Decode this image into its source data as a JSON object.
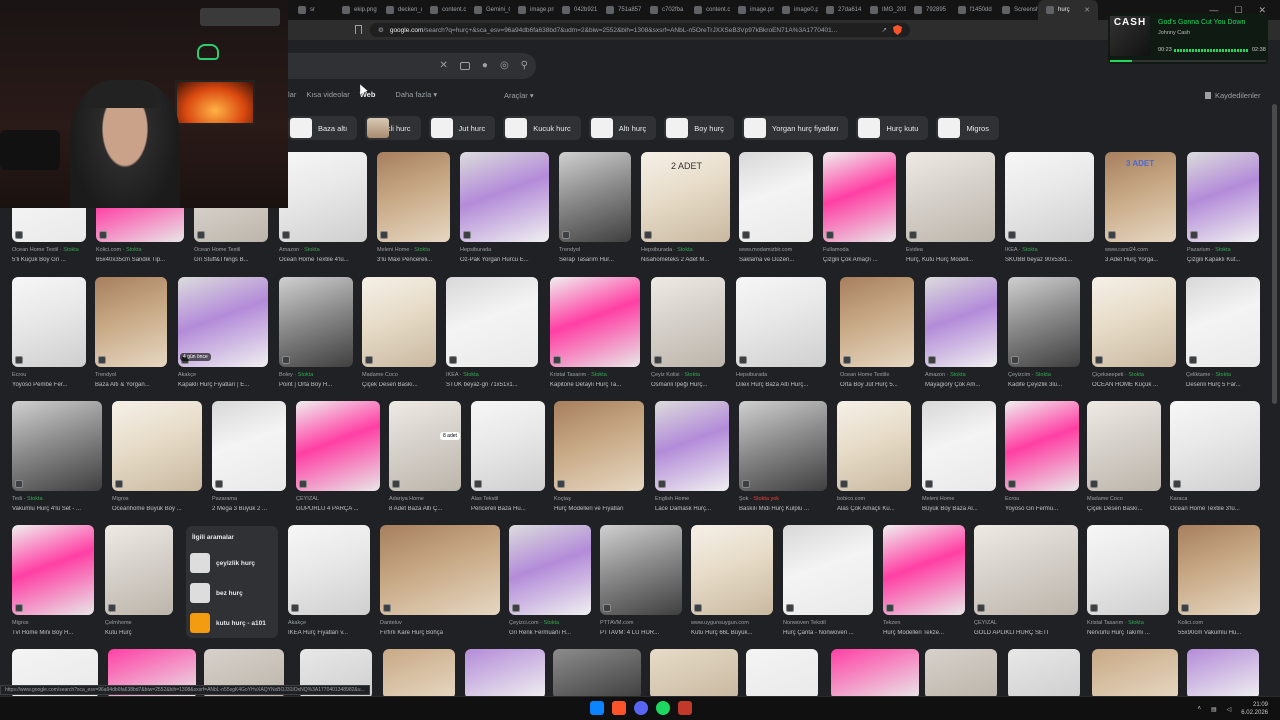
{
  "browser": {
    "tabs": [
      "sr",
      "ekip.png",
      "decken_d",
      "content.c",
      "Gemini_C",
      "image.pn",
      "042b921",
      "751a857",
      "c702fba",
      "content.c",
      "image.pn",
      "image0.p",
      "27da614",
      "IMG_209",
      "792895",
      "f1450dd",
      "Screensh",
      "hurç"
    ],
    "active_tab": "hurç",
    "url_host": "google.com",
    "url_rest": "/search?q=hurç+&sca_esv=96a94db6fa638bd7&udm=2&biw=2552&bih=1308&sxsrf=ANbL-n5OreTrJXXSeB3Vp97kBkroEN71A%3A1770401...",
    "status_url": "https://www.google.com/search?sca_esv=96a94db6fa638bd7&biw=2552&bih=1308&sxsrf=ANbL-n55sgK4GoYHvXAQYNxBOJ31IOxNQ%3A1770401348982&u..."
  },
  "music": {
    "art_text": "CASH",
    "song": "God's Gonna Cut You Down",
    "artist": "Johnny Cash",
    "time_elapsed": "00:23",
    "time_total": "02:38",
    "progress": 0.14
  },
  "search": {
    "nav": [
      "lar",
      "Kısa videolar",
      "Web",
      "Daha fazla ▾"
    ],
    "selected_nav": "Web",
    "tools": "Araçlar ▾",
    "saved": "Kaydedilenler",
    "chips": [
      "Baza altı",
      "Destekli hurc",
      "Jut hurc",
      "Kucuk hurc",
      "Altı hurç",
      "Boy hurç",
      "Yorgan hurç fiyatları",
      "Hurç kutu",
      "Migros"
    ]
  },
  "rows": [
    {
      "items": [
        {
          "source": "Ocean Home Textil",
          "stock": true,
          "title": "5'li Küçük Boy Gri ..."
        },
        {
          "source": "Kolici.com",
          "stock": true,
          "title": "65x40x35cm Sandık Tip..."
        },
        {
          "source": "Ocean Home Textil",
          "stock": false,
          "title": "Gri Stuff&Things B..."
        },
        {
          "source": "Amazon",
          "stock": true,
          "title": "Ocean Home Textile 4'lü..."
        },
        {
          "source": "Meleni Home",
          "stock": true,
          "title": "3'lü Maxi Pencereli..."
        },
        {
          "source": "Hepsiburada",
          "stock": false,
          "title": "Öz-Pak Yorgan Hurcu E..."
        },
        {
          "source": "Trendyol",
          "stock": false,
          "title": "Serap Tasarım Hur..."
        },
        {
          "source": "Hepsiburada",
          "stock": true,
          "title": "Nisahometeks 2 Adet M..."
        },
        {
          "source": "www.modamizbir.com",
          "stock": false,
          "title": "Saklama ve Düzen..."
        },
        {
          "source": "Fullamoda",
          "stock": false,
          "title": "Çizgili Çok Amaçlı ..."
        },
        {
          "source": "Evidea",
          "stock": false,
          "title": "Hurç, Kutu Hurç Modell..."
        },
        {
          "source": "IKEA",
          "stock": true,
          "title": "SKUBB beyaz 90x53x1..."
        },
        {
          "source": "www.carsi24.com",
          "stock": false,
          "title": "3 Adet Hurç Yorga..."
        },
        {
          "source": "Pazarium",
          "stock": true,
          "title": "Çizgili Kapaklı Kut..."
        }
      ]
    },
    {
      "items": [
        {
          "source": "Ecrou",
          "stock": false,
          "title": "Yoyoso Pembe Fer..."
        },
        {
          "source": "Trendyol",
          "stock": false,
          "title": "Baza Altı & Yorgan..."
        },
        {
          "source": "Akakçe",
          "stock": false,
          "title": "Kapaklı Hurç Fiyatları | E..."
        },
        {
          "source": "Boley",
          "stock": true,
          "title": "Point | Orta Boy H..."
        },
        {
          "source": "Madame Coco",
          "stock": false,
          "title": "Çiçek Desen Baskı..."
        },
        {
          "source": "IKEA",
          "stock": true,
          "title": "STUK beyaz-gri 71x51x1..."
        },
        {
          "source": "Kristal Tasarım",
          "stock": true,
          "title": "Kapitone Detaylı Hurç Ta..."
        },
        {
          "source": "Çeyiz Kolisi",
          "stock": true,
          "title": "Osmanlı İpeği Hurç..."
        },
        {
          "source": "Hepsiburada",
          "stock": false,
          "title": "Dilex Hurç Baza Altı Hurç..."
        },
        {
          "source": "Ocean Home Textile",
          "stock": false,
          "title": "Orta Boy Jüt Hurç 5..."
        },
        {
          "source": "Amazon",
          "stock": true,
          "title": "Mayagiory Çok Am..."
        },
        {
          "source": "Çeyizcim",
          "stock": true,
          "title": "Kadife Çeyizlik 3lü..."
        },
        {
          "source": "Çiçekseepeti",
          "stock": true,
          "title": "OCEAN HOME Küçük ..."
        },
        {
          "source": "Çeliktame",
          "stock": true,
          "title": "Desenli Hurç 5 Far..."
        }
      ]
    },
    {
      "items": [
        {
          "source": "Tedi",
          "stock": true,
          "title": "Vakumlu Hurç 4'lü Set - ..."
        },
        {
          "source": "Migros",
          "stock": false,
          "title": "Oceanhome Büyük Boy ..."
        },
        {
          "source": "Pazarama",
          "stock": false,
          "title": "2 Mega 3 Büyük 2 ..."
        },
        {
          "source": "ÇEYİZAL",
          "stock": false,
          "title": "GÜPÜRLÜ 4 PARÇA ..."
        },
        {
          "source": "Adariya Home",
          "stock": false,
          "title": "8 Adet Baza Altı Ç..."
        },
        {
          "source": "Alas Tekstil",
          "stock": false,
          "title": "Pencereli Baza Hu..."
        },
        {
          "source": "Koçtaş",
          "stock": false,
          "title": "Hurç Modelleri ve Fiyatları"
        },
        {
          "source": "English Home",
          "stock": false,
          "title": "Lace Damask Hurç..."
        },
        {
          "source": "Şok",
          "stock": false,
          "out": true,
          "title": "Baskılı Midi Hurç Kulplu ..."
        },
        {
          "source": "bobico.com",
          "stock": false,
          "title": "Alas Çok Amaçlı Ku..."
        },
        {
          "source": "Meleni Home",
          "stock": false,
          "title": "Büyük Boy Baza Al..."
        },
        {
          "source": "Ecrou",
          "stock": false,
          "title": "Yoyoso Gri Fermu..."
        },
        {
          "source": "Madame Coco",
          "stock": false,
          "title": "Çiçek Desen Baskı..."
        },
        {
          "source": "Karaca",
          "stock": false,
          "title": "Ocean Home Textile 3'lü..."
        }
      ]
    },
    {
      "items": [
        {
          "source": "Migros",
          "stock": false,
          "title": "Tvl Home Mini Boy H..."
        },
        {
          "source": "Çelmhome",
          "stock": false,
          "title": "Kutu Hurç"
        },
        {
          "source": "Akakçe",
          "stock": false,
          "title": "IKEA Hurç Fiyatları v..."
        },
        {
          "source": "Danteluv",
          "stock": false,
          "title": "Fırfırlı Kare Hurç Bohça"
        },
        {
          "source": "Çeyizci.com",
          "stock": true,
          "title": "Gri Renk Fermuarlı H..."
        },
        {
          "source": "PTTAVM.com",
          "stock": false,
          "title": "PTTAVM: 4 LÜ HUR..."
        },
        {
          "source": "www.uygunsuygun.com",
          "stock": false,
          "title": "Kutu Hurç 66L Büyük..."
        },
        {
          "source": "Nonwoven Tekstil",
          "stock": false,
          "title": "Hurç Çanta - Nonwoven ..."
        },
        {
          "source": "Tekzen",
          "stock": false,
          "title": "Hurç Modelleri Tekze..."
        },
        {
          "source": "ÇEYİZAL",
          "stock": false,
          "title": "GOLD APLİKLİ HURÇ SETİ"
        },
        {
          "source": "Kristal Tasarım",
          "stock": true,
          "title": "Nervürlü Hurç Takımı ..."
        },
        {
          "source": "Kolici.com",
          "stock": false,
          "title": "55x90cm Vakumlu Hu..."
        }
      ]
    }
  ],
  "image_labels": {
    "adet_2": "2 ADET",
    "adet_3": "3 ADET",
    "adet_8": "8 adet",
    "gun": "4 gün önce"
  },
  "stock_text": "Stokta",
  "out_stock_text": "Stokta yok",
  "related": {
    "heading": "İlgili aramalar",
    "items": [
      "çeyizlik hurç",
      "bez hurç",
      "kutu hurç - a101"
    ]
  },
  "clock": {
    "time": "21:09",
    "date": "6.02.2026"
  }
}
